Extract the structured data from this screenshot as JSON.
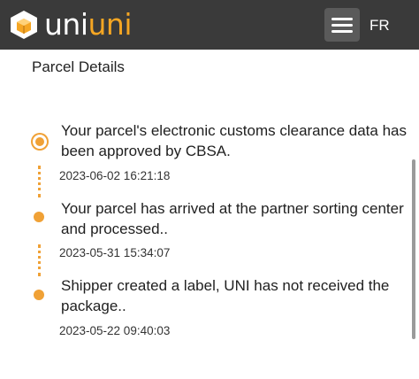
{
  "header": {
    "logo_text_part1": "uni",
    "logo_text_part2": "uni",
    "logo_icon": "box-logo-icon",
    "menu_icon": "hamburger-menu-icon",
    "language_label": "FR",
    "background_color": "#3a3a3a",
    "brand_color": "#f5a623"
  },
  "section": {
    "title": "Parcel Details"
  },
  "timeline": [
    {
      "status": "Your parcel's electronic customs clearance data has been approved by CBSA.",
      "datetime": "2023-06-02 16:21:18",
      "current": true
    },
    {
      "status": "Your parcel has arrived at the partner sorting center and processed..",
      "datetime": "2023-05-31 15:34:07",
      "current": false
    },
    {
      "status": "Shipper created a label, UNI has not received the package..",
      "datetime": "2023-05-22 09:40:03",
      "current": false
    }
  ],
  "timeline_color": "#f0a136"
}
